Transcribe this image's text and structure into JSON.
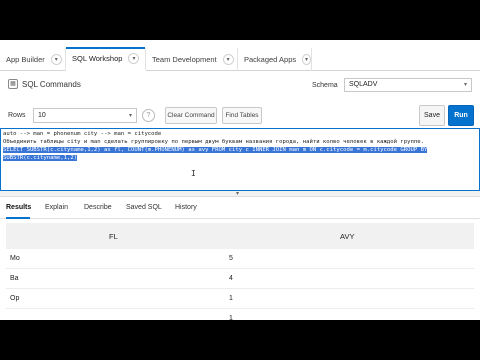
{
  "nav": {
    "tabs": [
      {
        "label": "App Builder"
      },
      {
        "label": "SQL Workshop"
      },
      {
        "label": "Team Development"
      },
      {
        "label": "Packaged Apps"
      }
    ]
  },
  "header": {
    "title": "SQL Commands",
    "schema_label": "Schema",
    "schema_value": "SQLADV"
  },
  "toolbar": {
    "rows_label": "Rows",
    "rows_value": "10",
    "clear_command": "Clear Command",
    "find_tables": "Find Tables",
    "save": "Save",
    "run": "Run"
  },
  "editor": {
    "lines": [
      "auto --> man = phonenum city --> man = citycode",
      "Объединить таблицы city и man сделать группировку по первым двум буквам названия города, найти колво человек в каждой группе.",
      "SELECT SUBSTR(c.cityname,1,2) as fl, COUNT(m.PHONENUM) as avy  FROM city c INNER JOIN man m ON c.citycode = m.citycode GROUP BY",
      "SUBSTR(c.cityname,1,2)"
    ]
  },
  "results": {
    "tabs": [
      "Results",
      "Explain",
      "Describe",
      "Saved SQL",
      "History"
    ],
    "columns": [
      "FL",
      "AVY"
    ],
    "rows": [
      {
        "fl": "Mo",
        "avy": "5"
      },
      {
        "fl": "Ba",
        "avy": "4"
      },
      {
        "fl": "Op",
        "avy": "1"
      },
      {
        "fl": "",
        "avy": "1"
      }
    ]
  },
  "colors": {
    "accent": "#0572ce",
    "selection": "#3875d7"
  }
}
